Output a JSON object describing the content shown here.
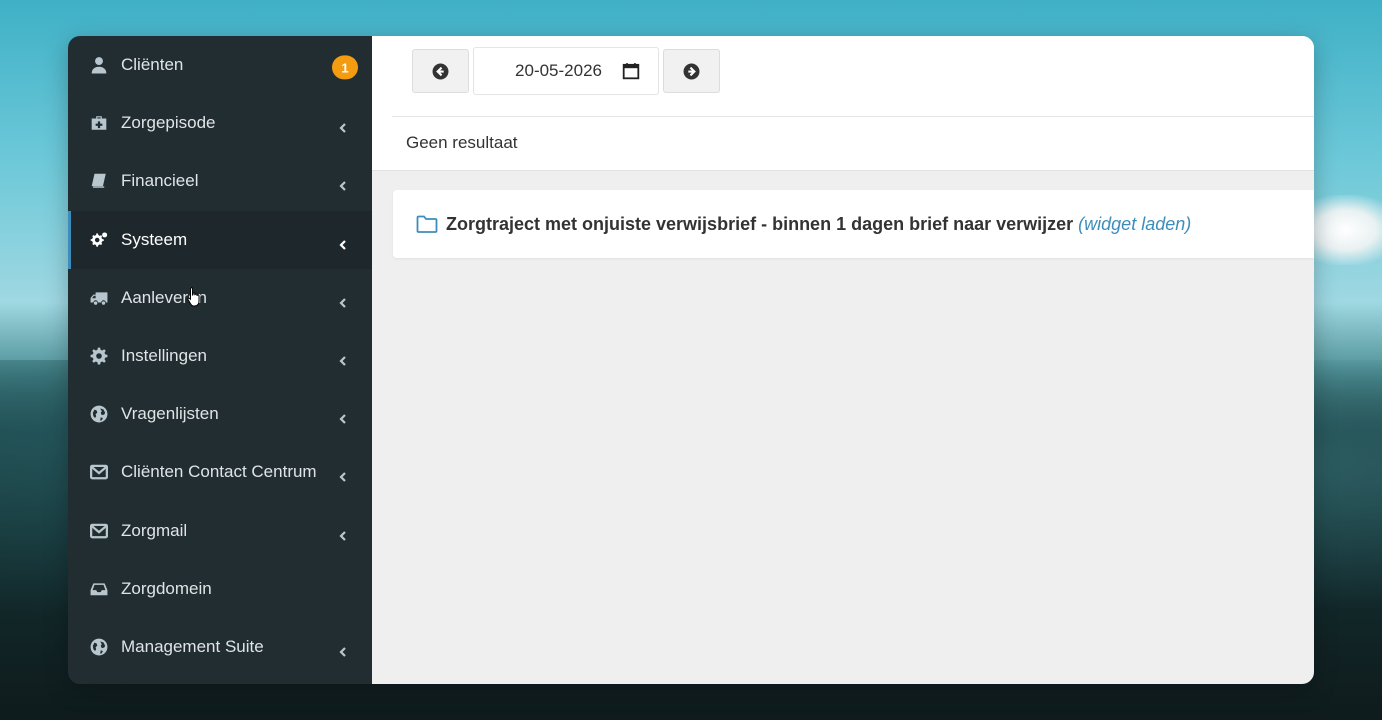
{
  "sidebar": {
    "items": [
      {
        "label": "Cliënten",
        "icon": "user-icon",
        "badge": "1"
      },
      {
        "label": "Zorgepisode",
        "icon": "medkit-icon"
      },
      {
        "label": "Financieel",
        "icon": "book-icon"
      },
      {
        "label": "Systeem",
        "icon": "gears-icon",
        "active": true
      },
      {
        "label": "Aanleveren",
        "icon": "truck-icon"
      },
      {
        "label": "Instellingen",
        "icon": "gear-icon"
      },
      {
        "label": "Vragenlijsten",
        "icon": "globe-icon"
      },
      {
        "label": "Cliënten Contact Centrum",
        "icon": "envelope-icon"
      },
      {
        "label": "Zorgmail",
        "icon": "envelope-icon"
      },
      {
        "label": "Zorgdomein",
        "icon": "inbox-icon"
      },
      {
        "label": "Management Suite",
        "icon": "globe-icon"
      }
    ]
  },
  "toolbar": {
    "date_value": "20-05-2026"
  },
  "results": {
    "empty_text": "Geen resultaat"
  },
  "widget": {
    "title": "Zorgtraject met onjuiste verwijsbrief - binnen 1 dagen brief naar verwijzer",
    "link": "(widget laden)"
  },
  "colors": {
    "sidebar_bg": "#222d32",
    "active_border": "#3c8dbc",
    "badge": "#f39c12",
    "link": "#3c8dbc"
  }
}
